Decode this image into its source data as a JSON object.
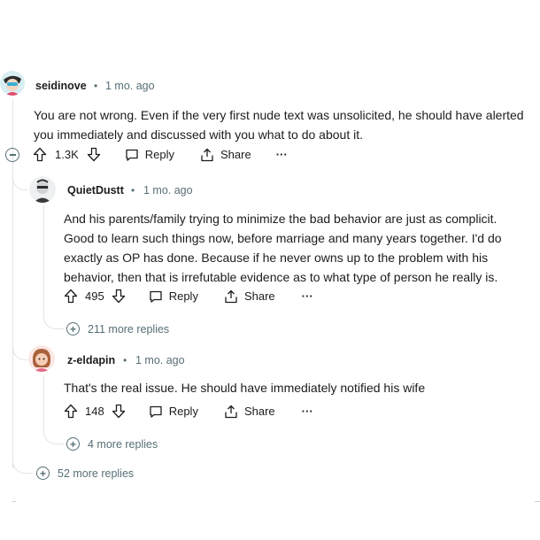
{
  "comments": [
    {
      "username": "seidinove",
      "separator": "•",
      "time": "1 mo. ago",
      "lines": [
        "You are not wrong. Even if the very first nude text was unsolicited, he should have alerted",
        "you immediately and discussed with you what to do about it."
      ],
      "votes": "1.3K",
      "reply_label": "Reply",
      "share_label": "Share",
      "more_label": "···",
      "more_replies": "52 more replies"
    },
    {
      "username": "QuietDustt",
      "separator": "•",
      "time": "1 mo. ago",
      "lines": [
        "And his parents/family trying to minimize the bad behavior are just as complicit.",
        "Good to learn such things now, before marriage and many years together. I'd do",
        "exactly as OP has done. Because if he never owns up to the problem with his",
        "behavior, then that is irrefutable evidence as to what type of person he really is."
      ],
      "votes": "495",
      "reply_label": "Reply",
      "share_label": "Share",
      "more_label": "···",
      "more_replies": "211 more replies"
    },
    {
      "username": "z-eldapin",
      "separator": "•",
      "time": "1 mo. ago",
      "lines": [
        "That's the real issue. He should have immediately notified his wife"
      ],
      "votes": "148",
      "reply_label": "Reply",
      "share_label": "Share",
      "more_label": "···",
      "more_replies": "4 more replies"
    }
  ],
  "colors": {
    "text": "#1c1c1c",
    "meta": "#576f76",
    "thread_line": "#dfe3e6"
  }
}
